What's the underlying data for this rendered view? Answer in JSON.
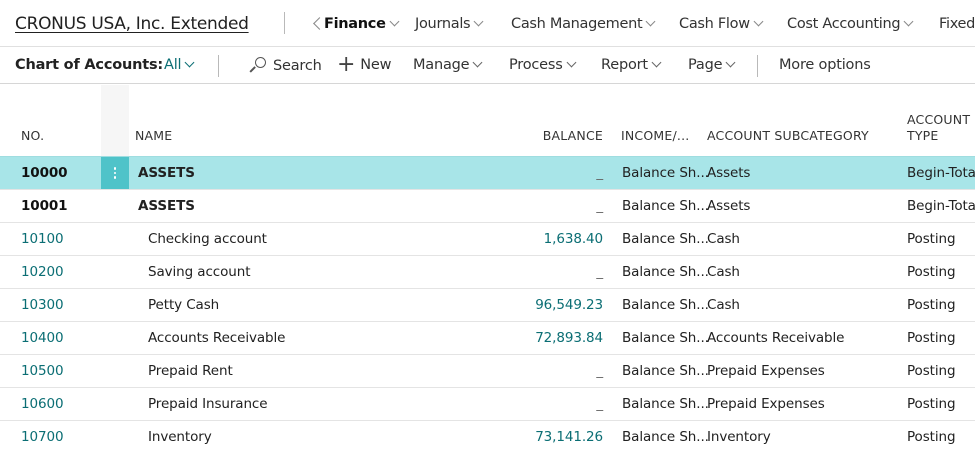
{
  "company": "CRONUS USA, Inc. Extended",
  "nav": [
    {
      "label": "Finance",
      "active": true
    },
    {
      "label": "Journals"
    },
    {
      "label": "Cash Management"
    },
    {
      "label": "Cash Flow"
    },
    {
      "label": "Cost Accounting"
    },
    {
      "label": "Fixed"
    }
  ],
  "actionbar": {
    "page_title": "Chart of Accounts:",
    "filter": "All",
    "search": "Search",
    "new": "New",
    "manage": "Manage",
    "process": "Process",
    "report": "Report",
    "page": "Page",
    "more": "More options"
  },
  "columns": {
    "no": "NO.",
    "name": "NAME",
    "balance": "BALANCE",
    "income": "INCOME/...",
    "subcategory": "ACCOUNT SUBCATEGORY",
    "type_line1": "ACCOUNT",
    "type_line2": "TYPE"
  },
  "rows": [
    {
      "no": "10000",
      "name": "ASSETS",
      "balance": "_",
      "income": "Balance Sh...",
      "subcategory": "Assets",
      "type": "Begin-Total"
    },
    {
      "no": "10001",
      "name": "ASSETS",
      "balance": "_",
      "income": "Balance Sh...",
      "subcategory": "Assets",
      "type": "Begin-Total"
    },
    {
      "no": "10100",
      "name": "Checking account",
      "balance": "1,638.40",
      "income": "Balance Sh...",
      "subcategory": "Cash",
      "type": "Posting"
    },
    {
      "no": "10200",
      "name": "Saving account",
      "balance": "_",
      "income": "Balance Sh...",
      "subcategory": "Cash",
      "type": "Posting"
    },
    {
      "no": "10300",
      "name": "Petty Cash",
      "balance": "96,549.23",
      "income": "Balance Sh...",
      "subcategory": "Cash",
      "type": "Posting"
    },
    {
      "no": "10400",
      "name": "Accounts Receivable",
      "balance": "72,893.84",
      "income": "Balance Sh...",
      "subcategory": "Accounts Receivable",
      "type": "Posting"
    },
    {
      "no": "10500",
      "name": "Prepaid Rent",
      "balance": "_",
      "income": "Balance Sh...",
      "subcategory": "Prepaid Expenses",
      "type": "Posting"
    },
    {
      "no": "10600",
      "name": "Prepaid Insurance",
      "balance": "_",
      "income": "Balance Sh...",
      "subcategory": "Prepaid Expenses",
      "type": "Posting"
    },
    {
      "no": "10700",
      "name": "Inventory",
      "balance": "73,141.26",
      "income": "Balance Sh...",
      "subcategory": "Inventory",
      "type": "Posting"
    }
  ],
  "colors": {
    "accent": "#0b6e74",
    "selected_row": "#a8e5e8",
    "row_menu": "#4fc3c9"
  }
}
